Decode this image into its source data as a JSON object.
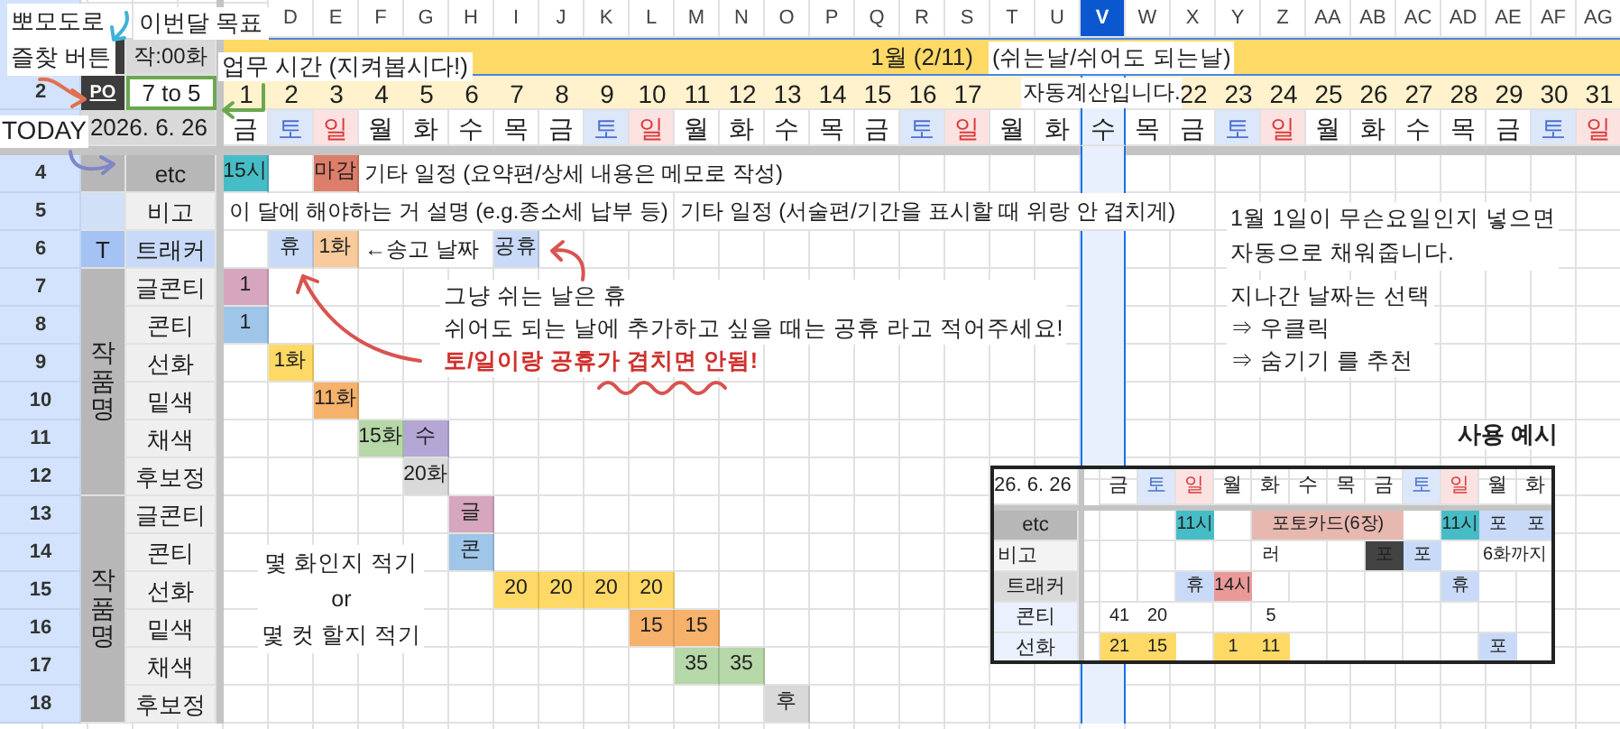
{
  "top_panel": {
    "goal": "작:00화",
    "pomodoro": "PO",
    "row_2_number": "2",
    "work_hours": "7 to 5",
    "today": "2026. 6. 26"
  },
  "month_bar": "1월 (2/11)",
  "days": [
    {
      "day": "1",
      "weekday": "금",
      "kind": "weekday",
      "selected": false
    },
    {
      "letter": "D",
      "day": "2",
      "weekday": "토",
      "kind": "saturday",
      "selected": false
    },
    {
      "letter": "E",
      "day": "3",
      "weekday": "일",
      "kind": "sunday",
      "selected": false
    },
    {
      "letter": "F",
      "day": "4",
      "weekday": "월",
      "kind": "weekday",
      "selected": false
    },
    {
      "letter": "G",
      "day": "5",
      "weekday": "화",
      "kind": "weekday",
      "selected": false
    },
    {
      "letter": "H",
      "day": "6",
      "weekday": "수",
      "kind": "weekday",
      "selected": false
    },
    {
      "letter": "I",
      "day": "7",
      "weekday": "목",
      "kind": "weekday",
      "selected": false
    },
    {
      "letter": "J",
      "day": "8",
      "weekday": "금",
      "kind": "weekday",
      "selected": false
    },
    {
      "letter": "K",
      "day": "9",
      "weekday": "토",
      "kind": "saturday",
      "selected": false
    },
    {
      "letter": "L",
      "day": "10",
      "weekday": "일",
      "kind": "sunday",
      "selected": false
    },
    {
      "letter": "M",
      "day": "11",
      "weekday": "월",
      "kind": "weekday",
      "selected": false
    },
    {
      "letter": "N",
      "day": "12",
      "weekday": "화",
      "kind": "weekday",
      "selected": false
    },
    {
      "letter": "O",
      "day": "13",
      "weekday": "수",
      "kind": "weekday",
      "selected": false
    },
    {
      "letter": "P",
      "day": "14",
      "weekday": "목",
      "kind": "weekday",
      "selected": false
    },
    {
      "letter": "Q",
      "day": "15",
      "weekday": "금",
      "kind": "weekday",
      "selected": false
    },
    {
      "letter": "R",
      "day": "16",
      "weekday": "토",
      "kind": "saturday",
      "selected": false
    },
    {
      "letter": "S",
      "day": "17",
      "weekday": "일",
      "kind": "sunday",
      "selected": false
    },
    {
      "letter": "T",
      "weekday": "월",
      "kind": "weekday",
      "selected": false
    },
    {
      "letter": "U",
      "weekday": "화",
      "kind": "weekday",
      "selected": false
    },
    {
      "letter": "V",
      "weekday": "수",
      "kind": "weekday",
      "selected": true
    },
    {
      "letter": "W",
      "weekday": "목",
      "kind": "weekday",
      "selected": false
    },
    {
      "letter": "X",
      "day": "22",
      "weekday": "금",
      "kind": "weekday",
      "selected": false
    },
    {
      "letter": "Y",
      "day": "23",
      "weekday": "토",
      "kind": "saturday",
      "selected": false
    },
    {
      "letter": "Z",
      "day": "24",
      "weekday": "일",
      "kind": "sunday",
      "selected": false
    },
    {
      "letter": "AA",
      "day": "25",
      "weekday": "월",
      "kind": "weekday",
      "selected": false
    },
    {
      "letter": "AB",
      "day": "26",
      "weekday": "화",
      "kind": "weekday",
      "selected": false
    },
    {
      "letter": "AC",
      "day": "27",
      "weekday": "수",
      "kind": "weekday",
      "selected": false
    },
    {
      "letter": "AD",
      "day": "28",
      "weekday": "목",
      "kind": "weekday",
      "selected": false
    },
    {
      "letter": "AE",
      "day": "29",
      "weekday": "금",
      "kind": "weekday",
      "selected": false
    },
    {
      "letter": "AF",
      "day": "30",
      "weekday": "토",
      "kind": "saturday",
      "selected": false
    },
    {
      "letter": "AG",
      "day": "31",
      "weekday": "일",
      "kind": "sunday",
      "selected": false
    }
  ],
  "rows": [
    {
      "number": "4",
      "kind": "etc",
      "label": "etc",
      "cells": [
        {
          "text": "15시",
          "color": "#46bdc6"
        },
        null,
        {
          "text": "마감",
          "color": "#dd7e6b"
        },
        {
          "kind": "note",
          "text": "기타 일정 (요약편/상세 내용은 메모로 작성)"
        }
      ]
    },
    {
      "number": "5",
      "kind": "memo",
      "label": "비고",
      "cells": [
        {
          "kind": "note",
          "text": "이 달에 해야하는 거 설명 (e.g.종소세 납부 등)"
        },
        null,
        null,
        null,
        null,
        null,
        null,
        null,
        null,
        null,
        {
          "kind": "note",
          "text": "기타 일정 (서술편/기간을 표시할 때 위랑 안 겹치게)"
        }
      ]
    },
    {
      "number": "6",
      "kind": "tracker",
      "tag": "T",
      "label": "트래커",
      "cells": [
        null,
        {
          "text": "휴",
          "color": "#c9daf8"
        },
        {
          "text": "1화",
          "color": "#f9cb9c"
        },
        {
          "kind": "note",
          "text": "←송고 날짜"
        },
        null,
        null,
        {
          "text": "공휴",
          "color": "#c9daf8"
        }
      ]
    }
  ],
  "work_groups": [
    {
      "label": "작품명",
      "rows": [
        {
          "number": "7",
          "label": "글콘티",
          "cells": [
            {
              "text": "1",
              "color": "#d5a6bd"
            }
          ]
        },
        {
          "number": "8",
          "label": "콘티",
          "cells": [
            {
              "text": "1",
              "color": "#9fc5e8"
            }
          ]
        },
        {
          "number": "9",
          "label": "선화",
          "cells": [
            null,
            {
              "text": "1화",
              "color": "#ffd966"
            }
          ]
        },
        {
          "number": "10",
          "label": "밑색",
          "cells": [
            null,
            null,
            {
              "text": "11화",
              "color": "#f6b26b"
            }
          ]
        },
        {
          "number": "11",
          "label": "채색",
          "cells": [
            null,
            null,
            null,
            {
              "text": "15화",
              "color": "#b6d7a8"
            },
            {
              "text": "수",
              "color": "#b4a7d6"
            }
          ]
        },
        {
          "number": "12",
          "label": "후보정",
          "cells": [
            null,
            null,
            null,
            null,
            {
              "text": "20화",
              "color": "#d9d9d9"
            }
          ]
        }
      ]
    },
    {
      "label": "작품명",
      "rows": [
        {
          "number": "13",
          "label": "글콘티",
          "cells": [
            null,
            null,
            null,
            null,
            null,
            {
              "text": "글",
              "color": "#d5a6bd"
            }
          ]
        },
        {
          "number": "14",
          "label": "콘티",
          "cells": [
            null,
            null,
            null,
            null,
            null,
            {
              "text": "콘",
              "color": "#9fc5e8"
            }
          ]
        },
        {
          "number": "15",
          "label": "선화",
          "cells": [
            null,
            null,
            null,
            null,
            null,
            null,
            {
              "text": "20",
              "color": "#ffd966"
            },
            {
              "text": "20",
              "color": "#ffd966"
            },
            {
              "text": "20",
              "color": "#ffd966"
            },
            {
              "text": "20",
              "color": "#ffd966"
            }
          ]
        },
        {
          "number": "16",
          "label": "밑색",
          "cells": [
            null,
            null,
            null,
            null,
            null,
            null,
            null,
            null,
            null,
            {
              "text": "15",
              "color": "#f6b26b"
            },
            {
              "text": "15",
              "color": "#f6b26b"
            }
          ]
        },
        {
          "number": "17",
          "label": "채색",
          "cells": [
            null,
            null,
            null,
            null,
            null,
            null,
            null,
            null,
            null,
            null,
            {
              "text": "35",
              "color": "#b6d7a8"
            },
            {
              "text": "35",
              "color": "#b6d7a8"
            }
          ]
        },
        {
          "number": "18",
          "label": "후보정",
          "cells": [
            null,
            null,
            null,
            null,
            null,
            null,
            null,
            null,
            null,
            null,
            null,
            null,
            {
              "text": "후",
              "color": "#d9d9d9"
            }
          ]
        }
      ]
    }
  ],
  "annotations": {
    "pomodoro_note": [
      "뽀모도로",
      "즐찾 버튼"
    ],
    "goal_note": "이번달 목표",
    "hours_note": "업무 시간 (지켜봅시다!)",
    "today_note": "TODAY",
    "holiday_auto_note": [
      "(쉬는날/쉬어도 되는날)",
      "자동계산입니다."
    ],
    "rest_note": [
      "그냥 쉬는 날은 휴",
      "쉬어도 되는 날에 추가하고 싶을 때는 공휴 라고 적어주세요!"
    ],
    "rest_warning": "토/일이랑 공휴가 겹치면 안됨!",
    "count_note": [
      "몇 화인지 적기",
      "or",
      "몇 컷 할지 적기"
    ],
    "weekday_note": [
      "1월 1일이 무슨요일인지 넣으면",
      "자동으로 채워줍니다."
    ],
    "hide_note": [
      "지나간 날짜는 선택",
      "⇒ 우클릭",
      "⇒ 숨기기 를 추천"
    ],
    "example_title": "사용 예시"
  },
  "example": {
    "today": "26. 6. 26",
    "weekdays": [
      {
        "text": "금",
        "kind": "weekday"
      },
      {
        "text": "토",
        "kind": "saturday"
      },
      {
        "text": "일",
        "kind": "sunday"
      },
      {
        "text": "월",
        "kind": "weekday"
      },
      {
        "text": "화",
        "kind": "weekday"
      },
      {
        "text": "수",
        "kind": "weekday"
      },
      {
        "text": "목",
        "kind": "weekday"
      },
      {
        "text": "금",
        "kind": "weekday"
      },
      {
        "text": "토",
        "kind": "saturday"
      },
      {
        "text": "일",
        "kind": "sunday"
      },
      {
        "text": "월",
        "kind": "weekday"
      },
      {
        "text": "화",
        "kind": "weekday"
      }
    ],
    "rows": [
      {
        "label": "etc",
        "kind": "etc",
        "cells": [
          null,
          null,
          {
            "text": "11시",
            "color": "#46bdc6"
          },
          null,
          {
            "text": "포토카드(6장)",
            "color": "#e6b8af"
          },
          {
            "continues": true
          },
          {
            "continues": true
          },
          {
            "continues": true
          },
          null,
          {
            "text": "11시",
            "color": "#46bdc6"
          },
          {
            "text": "포",
            "color": "#c9daf8"
          },
          {
            "text": "포",
            "color": "#c9daf8"
          }
        ]
      },
      {
        "label": "비고",
        "kind": "memo",
        "cells": [
          null,
          null,
          null,
          null,
          {
            "text": "러"
          },
          null,
          null,
          {
            "text": "포",
            "color": "#434343"
          },
          {
            "text": "포",
            "color": "#c9daf8"
          },
          null,
          {
            "text": "6화까지"
          },
          {
            "continues": true
          }
        ]
      },
      {
        "label": "트래커",
        "kind": "tracker",
        "cells": [
          null,
          null,
          {
            "text": "휴",
            "color": "#c9daf8"
          },
          {
            "text": "14시",
            "color": "#ea9999"
          },
          null,
          null,
          null,
          null,
          null,
          {
            "text": "휴",
            "color": "#c9daf8"
          }
        ]
      },
      {
        "label": "콘티",
        "kind": "work",
        "cells": [
          {
            "text": "41"
          },
          {
            "text": "20"
          },
          null,
          null,
          {
            "text": "5"
          }
        ]
      },
      {
        "label": "선화",
        "kind": "work",
        "cells": [
          {
            "text": "21",
            "color": "#ffd966"
          },
          {
            "text": "15",
            "color": "#ffd966"
          },
          null,
          {
            "text": "1",
            "color": "#ffd966"
          },
          {
            "text": "11",
            "color": "#ffd966"
          },
          null,
          null,
          null,
          null,
          null,
          {
            "text": "포",
            "color": "#c9daf8"
          }
        ]
      }
    ]
  }
}
